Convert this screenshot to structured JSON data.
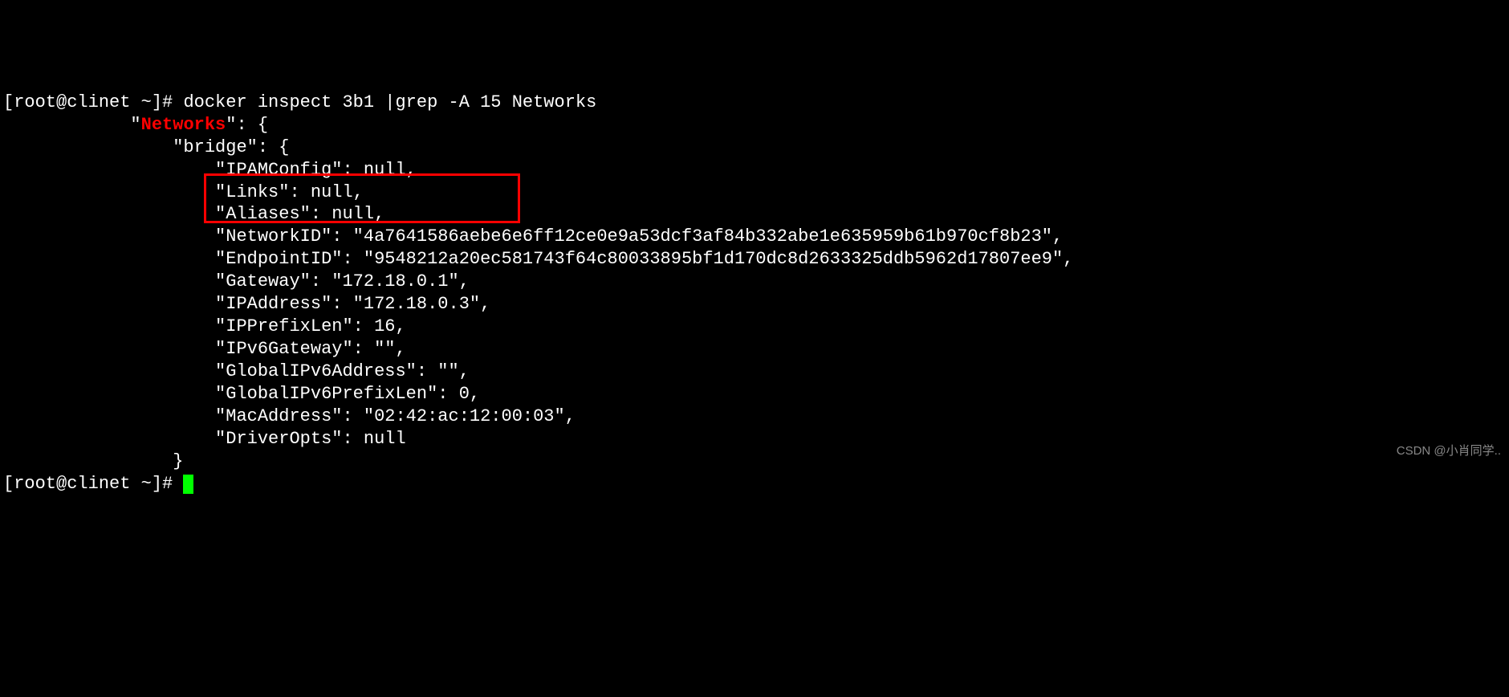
{
  "prompt1": {
    "user_host": "[root@clinet ~]# ",
    "command": "docker inspect 3b1 |grep -A 15 Networks"
  },
  "output": {
    "line1_pre": "            \"",
    "line1_match": "Networks",
    "line1_post": "\": {",
    "line2": "                \"bridge\": {",
    "line3": "                    \"IPAMConfig\": null,",
    "line4": "                    \"Links\": null,",
    "line5": "                    \"Aliases\": null,",
    "line6": "                    \"NetworkID\": \"4a7641586aebe6e6ff12ce0e9a53dcf3af84b332abe1e635959b61b970cf8b23\",",
    "line7": "                    \"EndpointID\": \"9548212a20ec581743f64c80033895bf1d170dc8d2633325ddb5962d17807ee9\",",
    "line8": "                    \"Gateway\": \"172.18.0.1\",",
    "line9": "                    \"IPAddress\": \"172.18.0.3\",",
    "line10": "                    \"IPPrefixLen\": 16,",
    "line11": "                    \"IPv6Gateway\": \"\",",
    "line12": "                    \"GlobalIPv6Address\": \"\",",
    "line13": "                    \"GlobalIPv6PrefixLen\": 0,",
    "line14": "                    \"MacAddress\": \"02:42:ac:12:00:03\",",
    "line15": "                    \"DriverOpts\": null",
    "line16": "                }"
  },
  "prompt2": {
    "user_host": "[root@clinet ~]# "
  },
  "watermark": "CSDN @小肖同学.."
}
